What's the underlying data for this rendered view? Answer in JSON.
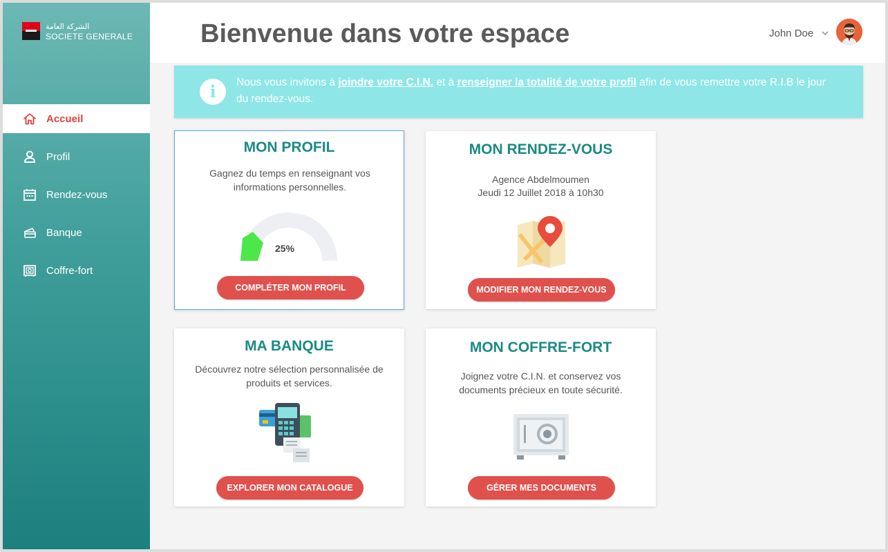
{
  "brand": {
    "arabic": "الشركة العامة",
    "name": "SOCIETE GENERALE",
    "red": "#e2001a"
  },
  "sidebar": {
    "items": [
      {
        "label": "Accueil",
        "icon": "home-icon",
        "active": true
      },
      {
        "label": "Profil",
        "icon": "user-icon",
        "active": false
      },
      {
        "label": "Rendez-vous",
        "icon": "calendar-icon",
        "active": false
      },
      {
        "label": "Banque",
        "icon": "bank-cards-icon",
        "active": false
      },
      {
        "label": "Coffre-fort",
        "icon": "safe-icon",
        "active": false
      }
    ]
  },
  "header": {
    "title": "Bienvenue dans votre espace",
    "user": "John Doe"
  },
  "banner": {
    "part1": "Nous vous invitons à ",
    "link1": "joindre votre C.I.N.",
    "part2": " et à ",
    "link2": "renseigner la totalité de votre profil",
    "part3": " afin de vous remettre votre R.I.B le jour du rendez-vous."
  },
  "cards": {
    "profile": {
      "title": "MON PROFIL",
      "desc": "Gagnez du temps en renseignant vos informations personnelles.",
      "progress_label": "25%",
      "progress": 0.25,
      "button": "COMPLÉTER MON PROFIL"
    },
    "appointment": {
      "title": "MON RENDEZ-VOUS",
      "agency": "Agence Abdelmoumen",
      "date": "Jeudi 12 Juillet 2018 à 10h30",
      "button": "MODIFIER MON RENDEZ-VOUS"
    },
    "bank": {
      "title": "MA BANQUE",
      "desc": "Découvrez notre sélection personnalisée de produits et services.",
      "button": "EXPLORER MON CATALOGUE"
    },
    "vault": {
      "title": "MON COFFRE-FORT",
      "desc": "Joignez votre C.I.N. et conservez vos documents précieux en toute sécurité.",
      "button": "GÉRER MES DOCUMENTS"
    }
  },
  "colors": {
    "teal": "#1a8a84",
    "button": "#e0504c",
    "banner": "#8ee6e6",
    "active_nav": "#e3413f"
  }
}
